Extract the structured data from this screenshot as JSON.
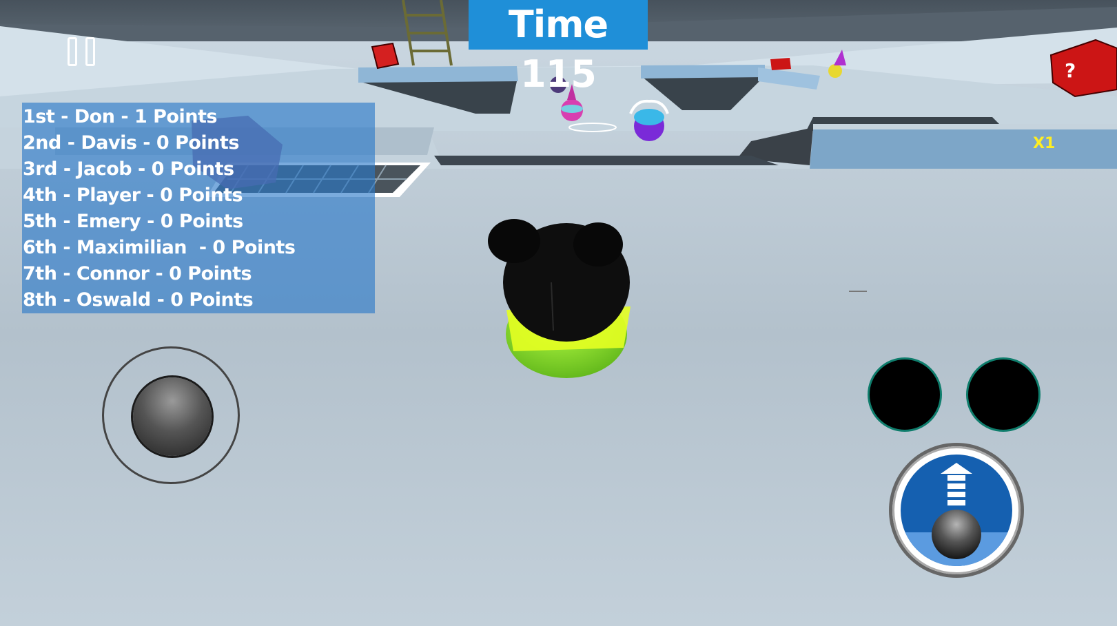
{
  "hud": {
    "timer_text": "Time 115",
    "multiplier_text": "X1"
  },
  "leaderboard": {
    "rows": [
      "1st - Don - 1 Points",
      "2nd - Davis - 0 Points",
      "3rd - Jacob - 0 Points",
      "4th - Player - 0 Points",
      "5th - Emery - 0 Points",
      "6th - Maximilian  - 0 Points",
      "7th - Connor - 0 Points",
      "8th - Oswald - 0 Points"
    ]
  },
  "controls": {
    "pause_icon": "pause-icon",
    "joystick_icon": "joystick-icon",
    "jump_icon": "jump-arrow-icon"
  },
  "colors": {
    "timer_bg": "#1f8fd8",
    "leaderboard_bg": "rgba(40,120,200,0.62)",
    "multiplier": "#ffee22",
    "action_ring": "#0f7d6c",
    "player_ball": "#8ee02a"
  }
}
